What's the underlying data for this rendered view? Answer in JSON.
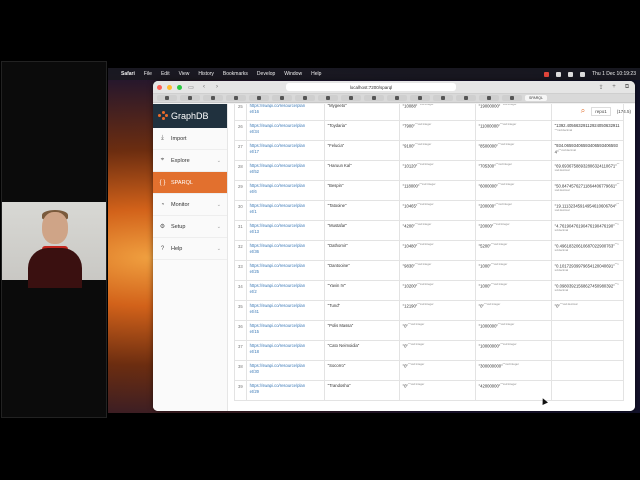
{
  "menubar": {
    "app": "Safari",
    "items": [
      "File",
      "Edit",
      "View",
      "History",
      "Bookmarks",
      "Develop",
      "Window",
      "Help"
    ],
    "clock": "Thu 1 Dec 10:19:23"
  },
  "browser": {
    "url": "localhost:7200/sparql",
    "active_tab": "SPARQL"
  },
  "app": {
    "logo": "GraphDB",
    "nav": [
      {
        "label": "Import",
        "icon": "import-icon",
        "chevron": false
      },
      {
        "label": "Explore",
        "icon": "explore-icon",
        "chevron": true
      },
      {
        "label": "SPARQL",
        "icon": "sparql-icon",
        "chevron": false,
        "active": true
      },
      {
        "label": "Monitor",
        "icon": "monitor-icon",
        "chevron": true
      },
      {
        "label": "Setup",
        "icon": "setup-icon",
        "chevron": true
      },
      {
        "label": "Help",
        "icon": "help-icon",
        "chevron": true
      }
    ],
    "repo": "repo1",
    "user": "(174.5)"
  },
  "results": {
    "rows": [
      {
        "idx": "25",
        "uri1": "https://swapi.co/resource/plan",
        "uri2": "et/16",
        "name": "\"Mygeeto\"",
        "v1": "\"10088\"",
        "t1": "^^xsd:integer",
        "v2": "\"19000000\"",
        "t2": "^^xsd:integer",
        "v3": "",
        "t3": ""
      },
      {
        "idx": "26",
        "uri1": "https://swapi.co/resource/plan",
        "uri2": "et/34",
        "name": "\"Toydaria\"",
        "v1": "\"7900\"",
        "t1": "^^xsd:integer",
        "v2": "\"11000000\"",
        "t2": "^^xsd:integer",
        "v3": "\"1392.40566329112924050632911",
        "t3": "^^xsd:decimal"
      },
      {
        "idx": "27",
        "uri1": "https://swapi.co/resource/plan",
        "uri2": "et/17",
        "name": "\"Felucia\"",
        "v1": "\"9100\"",
        "t1": "^^xsd:integer",
        "v2": "\"8500000\"",
        "t2": "^^xsd:integer",
        "v3": "\"934.065934065934065934065934\"",
        "t3": "^^xsd:decimal"
      },
      {
        "idx": "28",
        "uri1": "https://swapi.co/resource/plan",
        "uri2": "et/52",
        "name": "\"Haruun Kal\"",
        "v1": "\"10120\"",
        "t1": "^^xsd:integer",
        "v2": "\"705300\"",
        "t2": "^^xsd:integer",
        "v3": "\"69.69367588932806324110671\"",
        "t3": "^^xsd:decimal"
      },
      {
        "idx": "29",
        "uri1": "https://swapi.co/resource/plan",
        "uri2": "et/6",
        "name": "\"Bespin\"",
        "v1": "\"118000\"",
        "t1": "^^xsd:integer",
        "v2": "\"6000000\"",
        "t2": "^^xsd:integer",
        "v3": "\"50.84745762711864406779661\"",
        "t3": "^^xsd:decimal"
      },
      {
        "idx": "30",
        "uri1": "https://swapi.co/resource/plan",
        "uri2": "et/1",
        "name": "\"Tatooine\"",
        "v1": "\"10465\"",
        "t1": "^^xsd:integer",
        "v2": "\"200000\"",
        "t2": "^^xsd:integer",
        "v3": "\"19.11132345914954610606784\"",
        "t3": "^^xsd:decimal"
      },
      {
        "idx": "31",
        "uri1": "https://swapi.co/resource/plan",
        "uri2": "et/13",
        "name": "\"Mustafar\"",
        "v1": "\"4200\"",
        "t1": "^^xsd:integer",
        "v2": "\"20000\"",
        "t2": "^^xsd:integer",
        "v3": "\"4.76190476190476190476190\"",
        "t3": "^^xsd:decimal"
      },
      {
        "idx": "32",
        "uri1": "https://swapi.co/resource/plan",
        "uri2": "et/36",
        "name": "\"Dathomir\"",
        "v1": "\"10480\"",
        "t1": "^^xsd:integer",
        "v2": "\"5200\"",
        "t2": "^^xsd:integer",
        "v3": "\"0.49618320610687022900763\"",
        "t3": "^^xsd:decimal"
      },
      {
        "idx": "33",
        "uri1": "https://swapi.co/resource/plan",
        "uri2": "et/25",
        "name": "\"Dantooine\"",
        "v1": "\"9830\"",
        "t1": "^^xsd:integer",
        "v2": "\"1000\"",
        "t2": "^^xsd:integer",
        "v3": "\"0.10172939979654120040691\"",
        "t3": "^^xsd:decimal"
      },
      {
        "idx": "34",
        "uri1": "https://swapi.co/resource/plan",
        "uri2": "et/2",
        "name": "\"Yavin IV\"",
        "v1": "\"10200\"",
        "t1": "^^xsd:integer",
        "v2": "\"1000\"",
        "t2": "^^xsd:integer",
        "v3": "\"0.09803921568627450980392\"",
        "t3": "^^xsd:decimal"
      },
      {
        "idx": "35",
        "uri1": "https://swapi.co/resource/plan",
        "uri2": "et/41",
        "name": "\"Tund\"",
        "v1": "\"12190\"",
        "t1": "^^xsd:integer",
        "v2": "\"0\"",
        "t2": "^^xsd:integer",
        "v3": "\"0\"",
        "t3": "^^xsd:decimal"
      },
      {
        "idx": "36",
        "uri1": "https://swapi.co/resource/plan",
        "uri2": "et/15",
        "name": "\"Polis Massa\"",
        "v1": "\"0\"",
        "t1": "^^xsd:integer",
        "v2": "\"1000000\"",
        "t2": "^^xsd:integer",
        "v3": "",
        "t3": ""
      },
      {
        "idx": "37",
        "uri1": "https://swapi.co/resource/plan",
        "uri2": "et/18",
        "name": "\"Cato Neimoidia\"",
        "v1": "\"0\"",
        "t1": "^^xsd:integer",
        "v2": "\"10000000\"",
        "t2": "^^xsd:integer",
        "v3": "",
        "t3": ""
      },
      {
        "idx": "38",
        "uri1": "https://swapi.co/resource/plan",
        "uri2": "et/30",
        "name": "\"Socorro\"",
        "v1": "\"0\"",
        "t1": "^^xsd:integer",
        "v2": "\"300000000\"",
        "t2": "^^xsd:integer",
        "v3": "",
        "t3": ""
      },
      {
        "idx": "39",
        "uri1": "https://swapi.co/resource/plan",
        "uri2": "et/29",
        "name": "\"Trandosha\"",
        "v1": "\"0\"",
        "t1": "^^xsd:integer",
        "v2": "\"42000000\"",
        "t2": "^^xsd:integer",
        "v3": "",
        "t3": ""
      }
    ]
  }
}
